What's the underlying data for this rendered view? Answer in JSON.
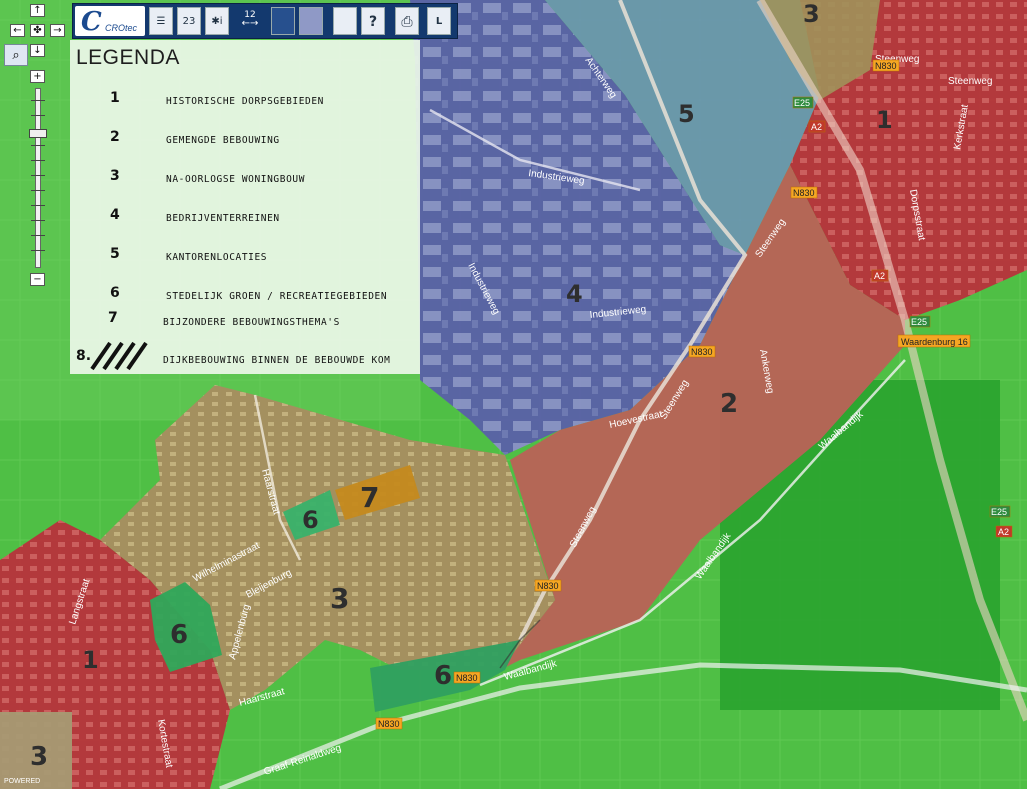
{
  "toolbar": {
    "logo_text": "CROtec",
    "btn_layers": "☰",
    "btn_23": "23",
    "btn_info": "✱i",
    "scale_text": "12",
    "btn_help": "?",
    "btn_print": "⎙",
    "btn_list": "L"
  },
  "nav": {
    "up": "↑",
    "left": "←",
    "center": "✤",
    "right": "→",
    "down": "↓",
    "zoom_in": "+",
    "zoom_out": "−",
    "magnifier": "⌕"
  },
  "legend": {
    "title": "LEGENDA",
    "items": [
      {
        "num": "1",
        "label": "HISTORISCHE DORPSGEBIEDEN"
      },
      {
        "num": "2",
        "label": "GEMENGDE BEBOUWING"
      },
      {
        "num": "3",
        "label": "NA-OORLOGSE WONINGBOUW"
      },
      {
        "num": "4",
        "label": "BEDRIJVENTERREINEN"
      },
      {
        "num": "5",
        "label": "KANTORENLOCATIES"
      },
      {
        "num": "6",
        "label": "STEDELIJK GROEN / RECREATIEGEBIEDEN"
      },
      {
        "num": "7",
        "label": "BIJZONDERE BEBOUWINGSTHEMA'S"
      },
      {
        "num": "8.",
        "label": "DIJKBEBOUWING BINNEN DE BEBOUWDE KOM"
      }
    ]
  },
  "map": {
    "zones": {
      "z1_left": "1",
      "z1_right": "1",
      "z2": "2",
      "z3_center": "3",
      "z3_topright": "3",
      "z3_bottomleft": "3",
      "z4": "4",
      "z5": "5",
      "z6_a": "6",
      "z6_b": "6",
      "z6_c": "6",
      "z7": "7"
    },
    "streets": {
      "steenweg_1": "Steenweg",
      "steenweg_2": "Steenweg",
      "steenweg_3": "Steenweg",
      "steenweg_4": "Steenweg",
      "steenweg_5": "Steenweg",
      "industrieweg_1": "Industrieweg",
      "industrieweg_2": "Industrieweg",
      "industrieweg_3": "Industrieweg",
      "achterweg": "Achterweg",
      "dorpsstraat": "Dorpsstraat",
      "kerkstraat": "Kerkstraat",
      "waalbandijk_1": "Waalbandijk",
      "waalbandijk_2": "Waalbandijk",
      "waalbandijk_3": "Waalbandijk",
      "wilhelminastraat": "Wilhelminastraat",
      "haarstraat_1": "Haarstraat",
      "haarstraat_2": "Haarstraat",
      "graaf_reinaldweg": "Graaf-Reinaldweg",
      "langstraat": "Langstraat",
      "appelenburg": "Appelenburg",
      "bleijenburg": "Bleijenburg",
      "korte_straat": "Kortestraat",
      "hoevestraat": "Hoevestraat",
      "ankerweg": "Ankerweg"
    },
    "shields": {
      "n830_a": "N830",
      "n830_b": "N830",
      "n830_c": "N830",
      "n830_d": "N830",
      "n830_e": "N830",
      "n830_f": "N830",
      "a2_a": "A2",
      "a2_b": "A2",
      "a2_c": "A2",
      "e25_a": "E25",
      "e25_b": "E25",
      "e25_c": "E25",
      "waardenburg": "Waardenburg 16"
    },
    "attribution": "POWERED"
  }
}
